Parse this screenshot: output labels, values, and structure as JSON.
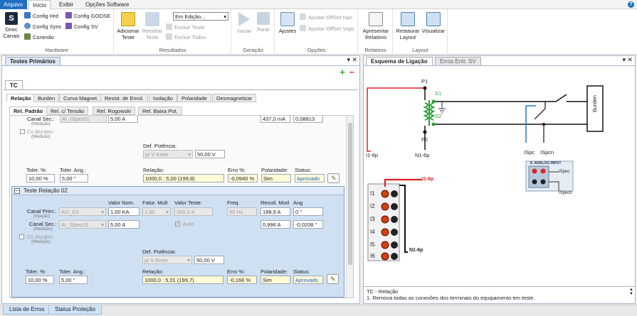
{
  "menu": {
    "arquivo": "Arquivo",
    "inicio": "Início",
    "exibir": "Exibir",
    "opcoes": "Opções Software",
    "help": "?"
  },
  "ribbon": {
    "hardware": {
      "label": "Hardware",
      "direc": "Direc\nCanais",
      "config_hrd": "Config Hrd",
      "config_sync": "Config Sync",
      "conexao": "Conexão",
      "config_goose": "Config GOOSE",
      "config_sv": "Config SV"
    },
    "resultados": {
      "label": "Resultados",
      "adicionar": "Adicionar Teste",
      "reeditar": "Reeditar Teste",
      "dropdown": "Em Edição...",
      "excluir_teste": "Excluir Teste",
      "excluir_todos": "Excluir Todos"
    },
    "geracao": {
      "label": "Geração",
      "iniciar": "Iniciar",
      "parar": "Parar"
    },
    "opcoes": {
      "label": "Opções",
      "ajustes": "Ajustes",
      "ajustar_ispc": "Ajustar OffSet Ispc",
      "ajustar_vspc": "Ajustar OffSet Vspc"
    },
    "relatorio": {
      "label": "Relatório",
      "apresentar": "Apresentar Relatório"
    },
    "layout": {
      "label": "Layout",
      "restaurar": "Restaurar Layout",
      "visualizar": "Visualizar"
    }
  },
  "left": {
    "panel_tab": "Testes Primários",
    "tc_tab": "TC",
    "tabs": [
      "Relação",
      "Burden",
      "Curva Magnet.",
      "Resist. de Enrol.",
      "Isolação",
      "Polaridade",
      "Desmagnetizar"
    ],
    "subtabs": [
      "Rel. Padrão",
      "Rel. c/ Tensão",
      "Rel. Rogowski",
      "Rel. Baixa Pot."
    ],
    "test1": {
      "canal_sec_label": "Canal Sec.:",
      "canal_sec_sub": "(Medição)",
      "canal_sec_val": "AI_ISpec01",
      "val_nom": "5,00 A",
      "resultado_partial": "437,0 mA",
      "ang_partial": "0,08813",
      "cn_burden": "Cn Burden:",
      "cn_burden_sub": "(Medição)",
      "def_potencia": "Def. Potência:",
      "def_pot_select": "p/ V Knee",
      "def_pot_val": "50,00 V",
      "toler_pct_label": "Toler. %:",
      "toler_pct": "10,00 %",
      "toler_ang_label": "Toler. Ang.:",
      "toler_ang": "5,00 °",
      "relacao_label": "Relação:",
      "relacao": "1000,0 : 5,00 (199,8)",
      "erro_label": "Erro %:",
      "erro": "-0,0940 %",
      "polaridade_label": "Polaridade:",
      "polaridade": "Sim",
      "status_label": "Status:",
      "status": "Aprovado"
    },
    "test2": {
      "title": "Teste Relação 02",
      "val_nom_label": "Valor Nom.",
      "fator_mult_label": "Fator. Mult",
      "valor_teste_label": "Valor Teste:",
      "freq_label": "Freq.",
      "result_mod_label": "Resutl. Mod",
      "ang_label": "Ang",
      "canal_prim_label": "Canal Prim.:",
      "canal_prim_sub": "(Injeção)",
      "canal_prim_val": "AO_I01",
      "prim_val_nom": "1,00 KA",
      "fator_mult": "1,00",
      "valor_teste": "200,0 A",
      "freq": "55 Hz",
      "prim_result": "198,9 A",
      "prim_ang": "0 °",
      "canal_sec_label": "Canal Sec.:",
      "canal_sec_sub": "(Medição)",
      "canal_sec_val": "AI_ISpec01",
      "sec_val_nom": "5,00 A",
      "auto": "Auto",
      "sec_result": "0,996 A",
      "sec_ang": "-0,0208 °",
      "cn_burden": "Cn Burden:",
      "cn_burden_sub": "(Medição)",
      "def_potencia": "Def. Potência:",
      "def_pot_select": "p/ V Knee",
      "def_pot_val": "50,00 V",
      "toler_pct_label": "Toler. %:",
      "toler_pct": "10,00 %",
      "toler_ang_label": "Toler. Ang.:",
      "toler_ang": "5,00 °",
      "relacao_label": "Relação:",
      "relacao": "1000,0 : 5,01 (199,7)",
      "erro_label": "Erro %:",
      "erro": "-0,166 %",
      "polaridade_label": "Polaridade:",
      "polaridade": "Sim",
      "status_label": "Status:",
      "status": "Aprovado"
    }
  },
  "right": {
    "tabs": [
      "Esquema de Ligação",
      "Erros Entr. SV"
    ],
    "diagram": {
      "p1": "P1",
      "p2": "P2",
      "s1": "S1",
      "s2": "S2",
      "i16p": "I1-6p",
      "n16p": "N1-6p",
      "ispc": "ISpc",
      "ispcn": "ISpcn",
      "burden": "Burden",
      "analog_title": "8. ANALOG INPUT",
      "analog_ispc": "ISpec",
      "analog_ispcn": "ISpecn",
      "channels": [
        "I1",
        "I2",
        "I3",
        "I4",
        "I5",
        "I6"
      ],
      "conn_i": "I1-6p",
      "conn_n": "N1-6p"
    },
    "info_title": "TC - Relação",
    "info_text": "1. Remova todas as conexões dos terminais do equipamento em teste."
  },
  "bottom": {
    "tab1": "Lista de Erros",
    "tab2": "Status Proteção"
  },
  "colors": {
    "accent": "#1e6fc2",
    "status": "#1760c9",
    "wire_red": "#e02020",
    "wire_blue": "#1f7ad0",
    "coil_green": "#2aa038"
  }
}
